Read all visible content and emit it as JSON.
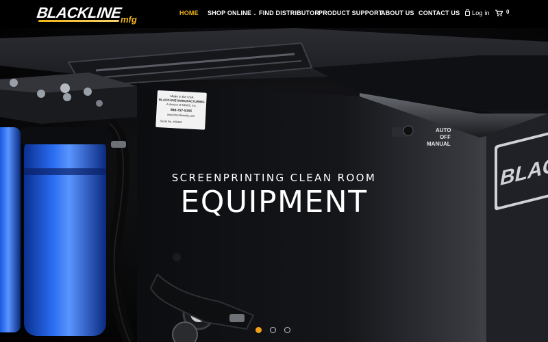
{
  "brand": {
    "logo_main": "BLACKLINE",
    "logo_sub": "mfg",
    "accent_color": "#f0b419"
  },
  "nav": {
    "home": "HOME",
    "shop_online": "SHOP ONLINE",
    "find_distributor": "FIND DISTRIBUTOR",
    "product_support": "PRODUCT SUPPORT",
    "about_us": "ABOUT US",
    "contact_us": "CONTACT US",
    "login": "Log in",
    "cart_count": "0"
  },
  "hero": {
    "subtitle": "SCREENPRINTING CLEAN ROOM",
    "title": "EQUIPMENT",
    "label_lines": [
      "Made in the USA",
      "BLACKLINE MANUFACTURING",
      "A division of MDWS, Inc.",
      "888-797-5166",
      "www.blacklinemfg.com",
      "Serial No. #00336"
    ],
    "switch_labels": [
      "AUTO",
      "OFF",
      "MANUAL"
    ],
    "machine_brand": "BLACKL",
    "slides": 3,
    "active_slide": 1
  }
}
